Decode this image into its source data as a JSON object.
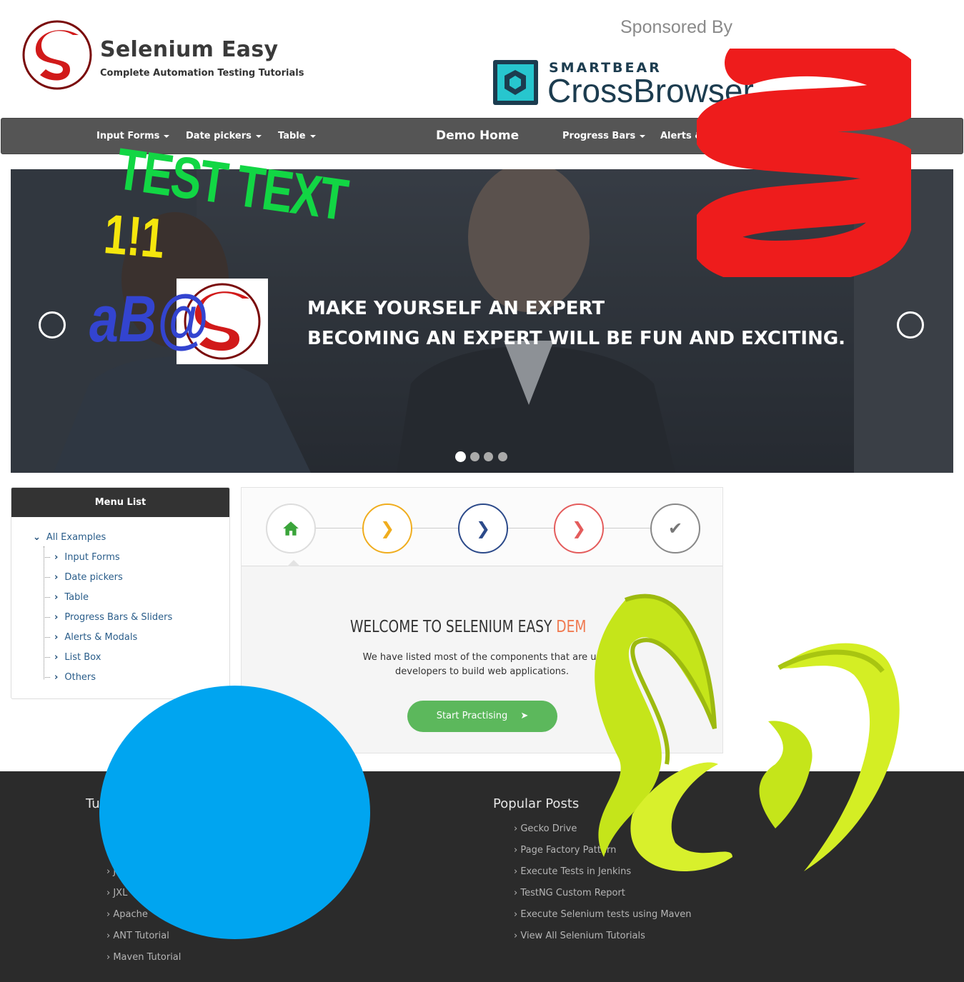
{
  "header": {
    "brand_title": "Selenium Easy",
    "brand_subtitle": "Complete Automation Testing Tutorials",
    "sponsored": "Sponsored By",
    "sponsor_company": "SMARTBEAR",
    "sponsor_product": "CrossBrowser"
  },
  "nav": {
    "items": [
      "Input Forms",
      "Date pickers",
      "Table",
      "Progress Bars",
      "Alerts & Modals"
    ],
    "home": "Demo Home"
  },
  "carousel": {
    "line1": "MAKE YOURSELF AN EXPERT",
    "line2": "BECOMING AN EXPERT WILL BE FUN AND EXCITING.",
    "active_slide": 1,
    "slide_count": 4
  },
  "overlays": {
    "test_text": "TEST TEXT",
    "number_text": "1!1",
    "ab_text": "aB@"
  },
  "menu": {
    "title": "Menu List",
    "root": "All Examples",
    "items": [
      "Input Forms",
      "Date pickers",
      "Table",
      "Progress Bars & Sliders",
      "Alerts & Modals",
      "List Box",
      "Others"
    ]
  },
  "wizard": {
    "step_icons": [
      "home-icon",
      "chevron-right-icon",
      "chevron-right-icon",
      "chevron-right-icon",
      "check-icon"
    ],
    "step_colors": [
      "#4cae4c",
      "#f0ad1e",
      "#2c4a8a",
      "#e45c5c",
      "#888888"
    ],
    "welcome": "WELCOME TO SELENIUM EASY",
    "welcome_accent": "DEM",
    "para_line1": "We have listed most of the components that are us",
    "para_line2": "developers to build web applications.",
    "button": "Start Practising"
  },
  "footer": {
    "tutorials_heading": "Tu",
    "tutorial_links": [
      "J",
      "JXL",
      "Apache",
      "ANT Tutorial",
      "Maven Tutorial"
    ],
    "popular_heading": "Popular Posts",
    "popular_links": [
      "Gecko Drive",
      "Page Factory Pattern",
      "Execute Tests in Jenkins",
      "TestNG Custom Report",
      "Execute Selenium tests using Maven",
      "View All Selenium Tutorials"
    ]
  }
}
